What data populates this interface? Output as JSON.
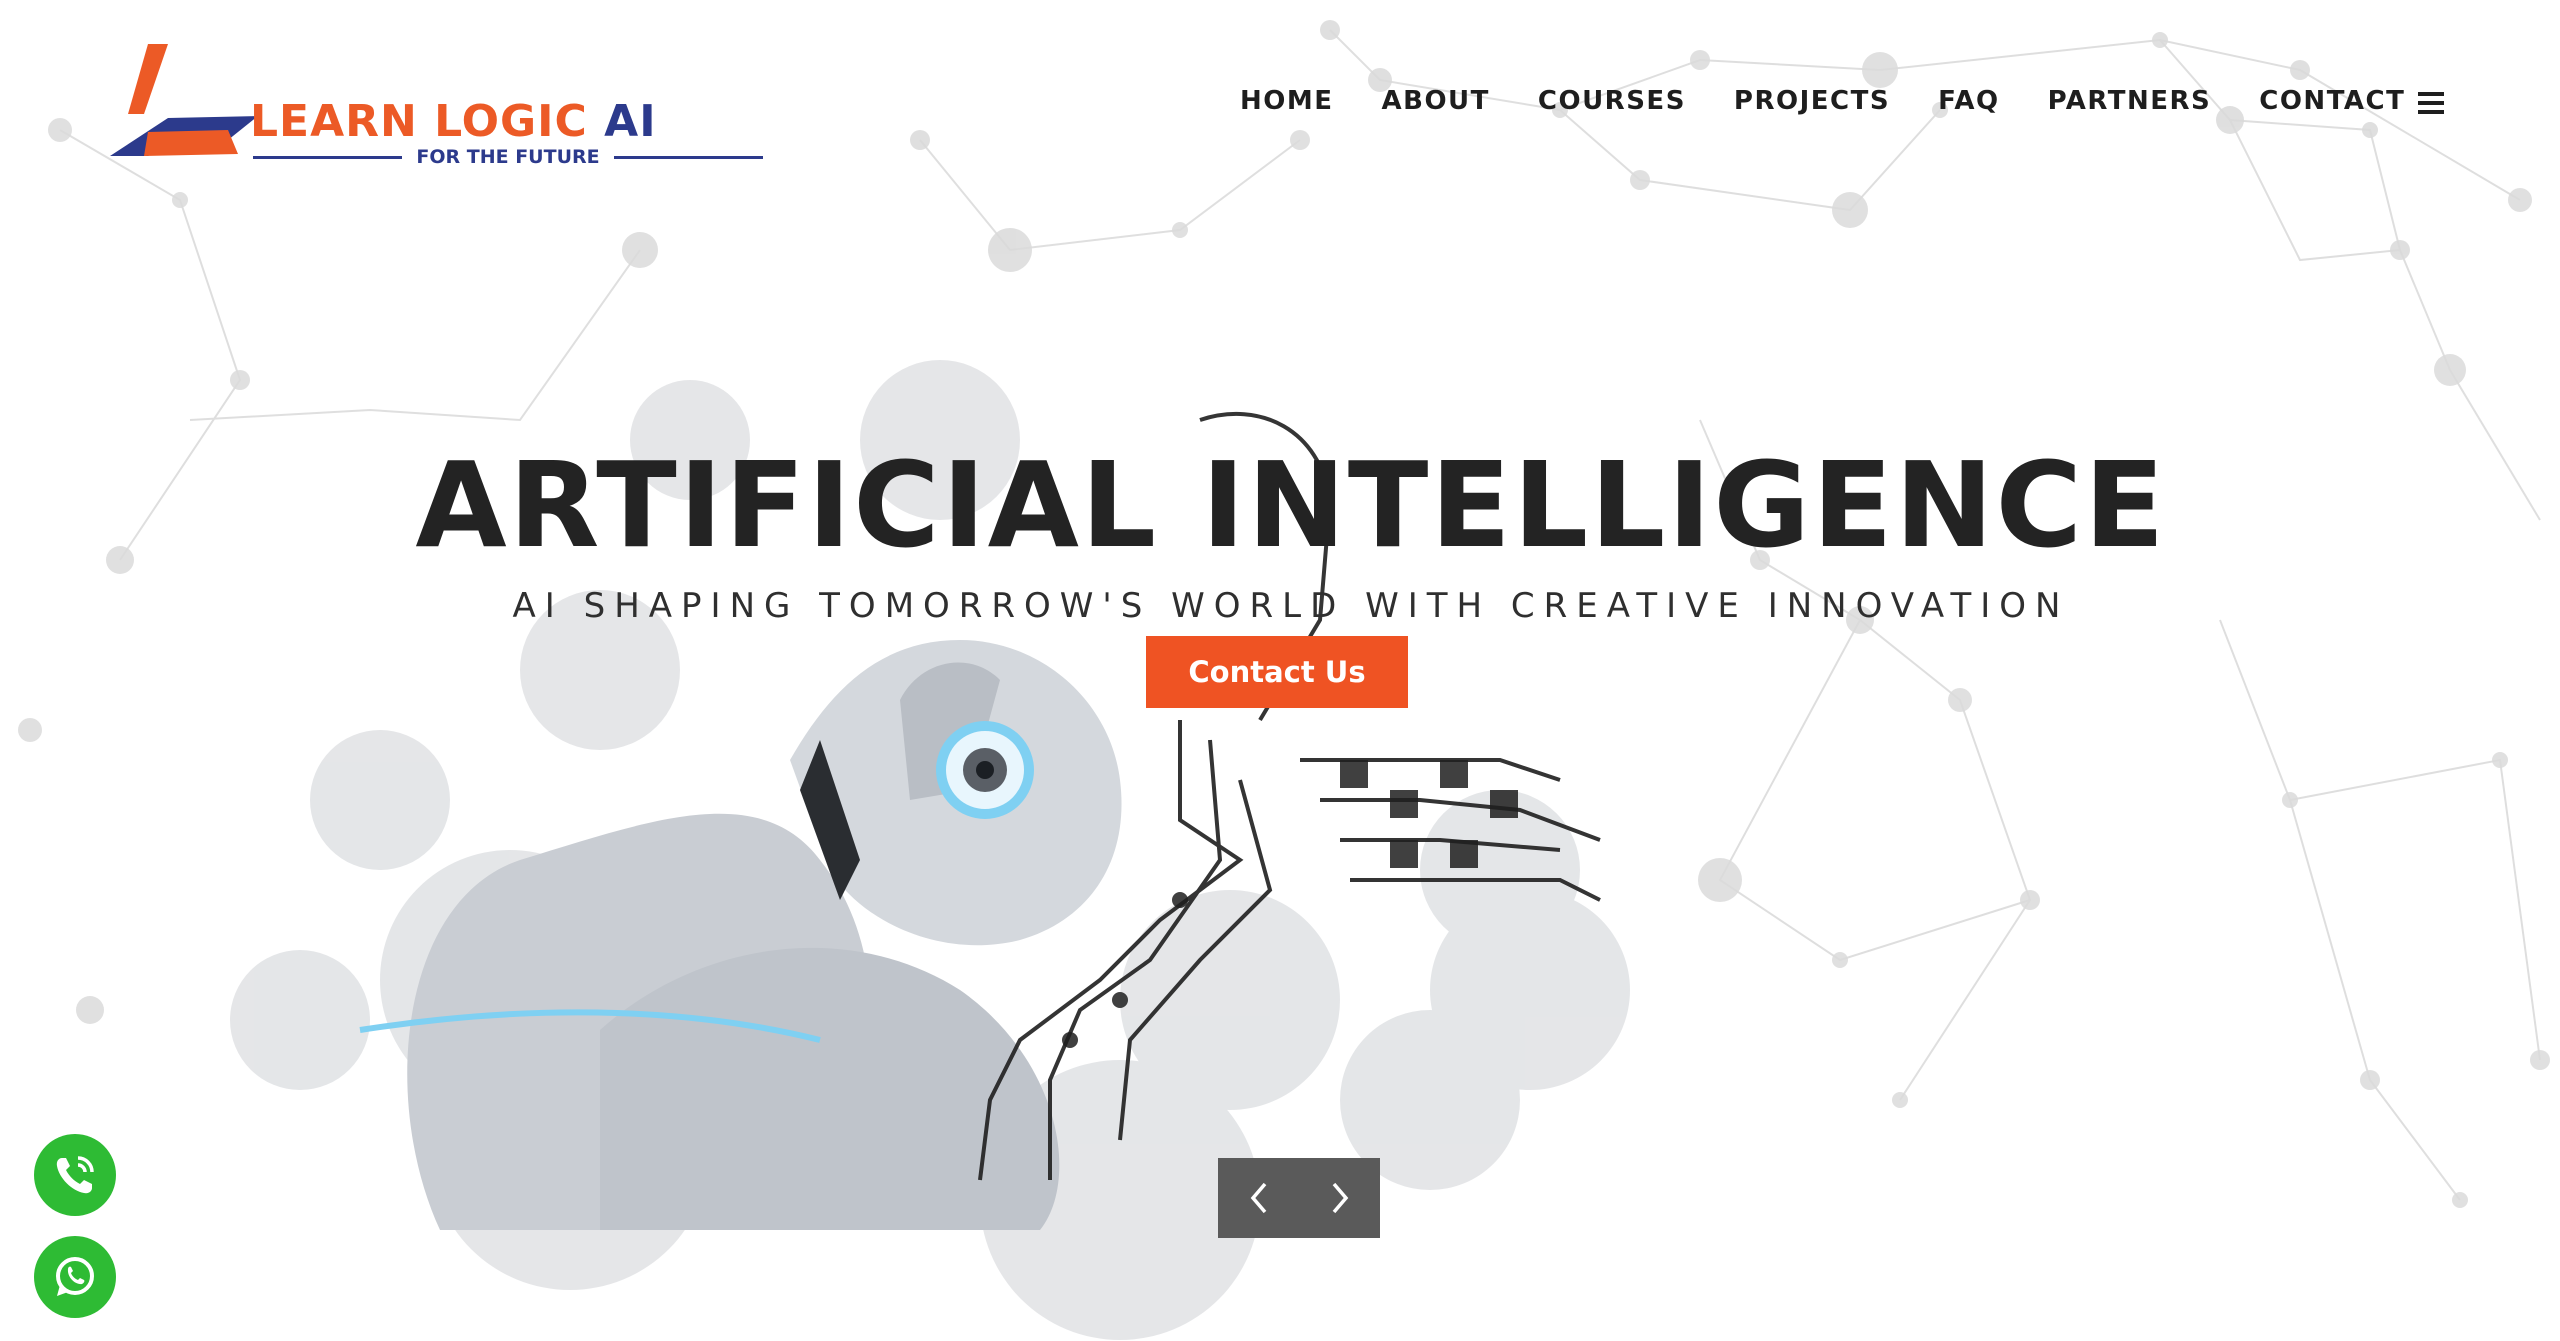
{
  "brand": {
    "name": "LEARN LOGIC",
    "name_suffix": "AI",
    "tagline": "FOR THE FUTURE",
    "colors": {
      "orange": "#ec5a26",
      "navy": "#2c3a8c"
    }
  },
  "nav": {
    "items": [
      {
        "label": "HOME"
      },
      {
        "label": "ABOUT"
      },
      {
        "label": "COURSES"
      },
      {
        "label": "PROJECTS"
      },
      {
        "label": "FAQ"
      },
      {
        "label": "PARTNERS"
      },
      {
        "label": "CONTACT"
      }
    ],
    "menu_icon": "hamburger-icon"
  },
  "hero": {
    "title": "ARTIFICIAL INTELLIGENCE",
    "subtitle": "AI SHAPING TOMORROW'S WORLD WITH CREATIVE INNOVATION",
    "cta_label": "Contact Us",
    "cta_color": "#ef5323",
    "image": "robot-with-circuit-board-brain"
  },
  "slider": {
    "prev_icon": "chevron-left-icon",
    "next_icon": "chevron-right-icon"
  },
  "floating": {
    "phone_icon": "phone-call-icon",
    "whatsapp_icon": "whatsapp-icon",
    "color": "#2ebb34"
  }
}
